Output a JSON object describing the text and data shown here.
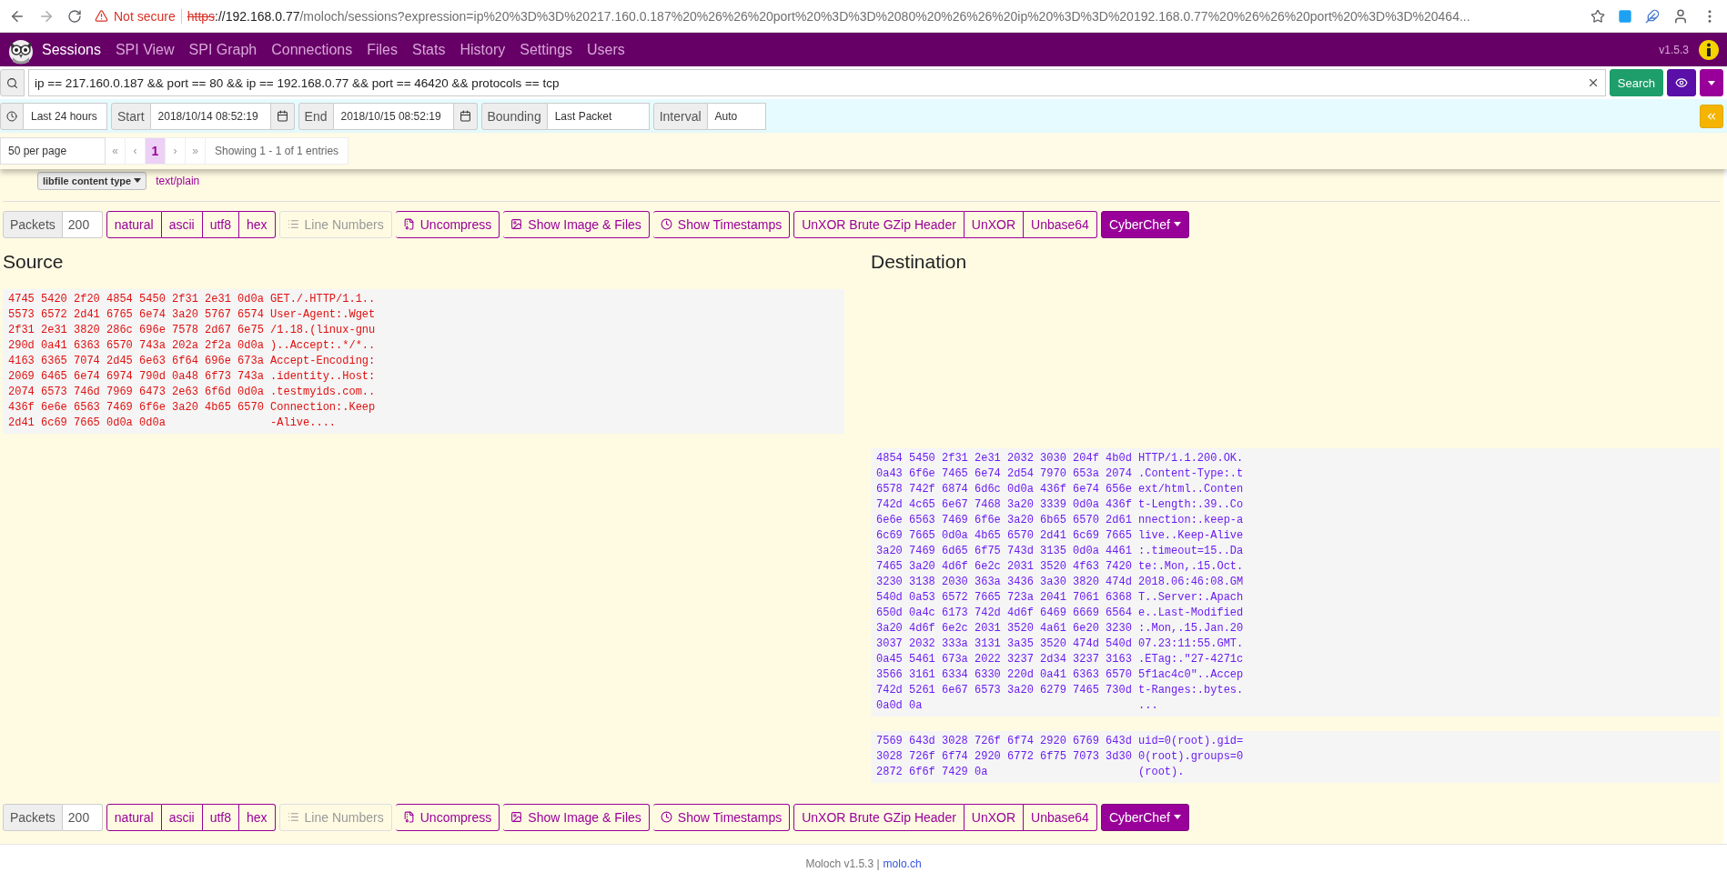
{
  "browser": {
    "security": "Not secure",
    "url": {
      "scheme": "https",
      "host": "://192.168.0.77",
      "path": "/moloch/sessions?expression=ip%20%3D%3D%20217.160.0.187%20%26%26%20port%20%3D%3D%2080%20%26%26%20ip%20%3D%3D%20192.168.0.77%20%26%26%20port%20%3D%3D%20464..."
    }
  },
  "nav": {
    "items": [
      {
        "label": "Sessions",
        "selected": true
      },
      {
        "label": "SPI View",
        "selected": false
      },
      {
        "label": "SPI Graph",
        "selected": false
      },
      {
        "label": "Connections",
        "selected": false
      },
      {
        "label": "Files",
        "selected": false
      },
      {
        "label": "Stats",
        "selected": false
      },
      {
        "label": "History",
        "selected": false
      },
      {
        "label": "Settings",
        "selected": false
      },
      {
        "label": "Users",
        "selected": false
      }
    ],
    "version": "v1.5.3"
  },
  "search": {
    "value": "ip == 217.160.0.187 && port == 80 && ip == 192.168.0.77 && port == 46420 && protocols == tcp",
    "button": "Search"
  },
  "time": {
    "range": "Last 24 hours",
    "start_label": "Start",
    "start": "2018/10/14 08:52:19",
    "end_label": "End",
    "end": "2018/10/15 08:52:19",
    "bounding_label": "Bounding",
    "bounding": "Last Packet",
    "interval_label": "Interval",
    "interval": "Auto"
  },
  "pagination": {
    "per_page": "50 per page",
    "pages": [
      {
        "label": "«",
        "selected": false,
        "disabled": true
      },
      {
        "label": "‹",
        "selected": false,
        "disabled": true
      },
      {
        "label": "1",
        "selected": true,
        "disabled": false
      },
      {
        "label": "›",
        "selected": false,
        "disabled": true
      },
      {
        "label": "»",
        "selected": false,
        "disabled": true
      }
    ],
    "info": "Showing 1 - 1 of 1 entries"
  },
  "libfile": {
    "label": "libfile content type",
    "value": "text/plain"
  },
  "toolbars": [
    {
      "packets_label": "Packets",
      "packets": "200",
      "formats": [
        "natural",
        "ascii",
        "utf8",
        "hex"
      ],
      "buttons": [
        {
          "kind": "lines",
          "label": "Line Numbers",
          "disabled": true
        },
        {
          "kind": "uncompress",
          "label": "Uncompress",
          "disabled": false
        },
        {
          "kind": "image",
          "label": "Show Image & Files",
          "disabled": false
        },
        {
          "kind": "time",
          "label": "Show Timestamps",
          "disabled": false
        }
      ],
      "decoders": [
        "UnXOR Brute GZip Header",
        "UnXOR",
        "Unbase64"
      ],
      "menu": "CyberChef"
    },
    {
      "packets_label": "Packets",
      "packets": "200",
      "formats": [
        "natural",
        "ascii",
        "utf8",
        "hex"
      ],
      "buttons": [
        {
          "kind": "lines",
          "label": "Line Numbers",
          "disabled": true
        },
        {
          "kind": "uncompress",
          "label": "Uncompress",
          "disabled": false
        },
        {
          "kind": "image",
          "label": "Show Image & Files",
          "disabled": false
        },
        {
          "kind": "time",
          "label": "Show Timestamps",
          "disabled": false
        }
      ],
      "decoders": [
        "UnXOR Brute GZip Header",
        "UnXOR",
        "Unbase64"
      ],
      "menu": "CyberChef"
    }
  ],
  "headings": {
    "source": "Source",
    "destination": "Destination"
  },
  "packets": [
    {
      "kind": "source",
      "lines": [
        {
          "hex": "4745 5420 2f20 4854 5450 2f31 2e31 0d0a",
          "ascii": "GET./.HTTP/1.1.."
        },
        {
          "hex": "5573 6572 2d41 6765 6e74 3a20 5767 6574",
          "ascii": "User-Agent:.Wget"
        },
        {
          "hex": "2f31 2e31 3820 286c 696e 7578 2d67 6e75",
          "ascii": "/1.18.(linux-gnu"
        },
        {
          "hex": "290d 0a41 6363 6570 743a 202a 2f2a 0d0a",
          "ascii": ")..Accept:.*/*.."
        },
        {
          "hex": "4163 6365 7074 2d45 6e63 6f64 696e 673a",
          "ascii": "Accept-Encoding:"
        },
        {
          "hex": "2069 6465 6e74 6974 790d 0a48 6f73 743a",
          "ascii": ".identity..Host:"
        },
        {
          "hex": "2074 6573 746d 7969 6473 2e63 6f6d 0d0a",
          "ascii": ".testmyids.com.."
        },
        {
          "hex": "436f 6e6e 6563 7469 6f6e 3a20 4b65 6570",
          "ascii": "Connection:.Keep"
        },
        {
          "hex": "2d41 6c69 7665 0d0a 0d0a",
          "ascii": "-Alive...."
        }
      ]
    },
    {
      "kind": "destination",
      "lines": [
        {
          "hex": "4854 5450 2f31 2e31 2032 3030 204f 4b0d",
          "ascii": "HTTP/1.1.200.OK."
        },
        {
          "hex": "0a43 6f6e 7465 6e74 2d54 7970 653a 2074",
          "ascii": ".Content-Type:.t"
        },
        {
          "hex": "6578 742f 6874 6d6c 0d0a 436f 6e74 656e",
          "ascii": "ext/html..Conten"
        },
        {
          "hex": "742d 4c65 6e67 7468 3a20 3339 0d0a 436f",
          "ascii": "t-Length:.39..Co"
        },
        {
          "hex": "6e6e 6563 7469 6f6e 3a20 6b65 6570 2d61",
          "ascii": "nnection:.keep-a"
        },
        {
          "hex": "6c69 7665 0d0a 4b65 6570 2d41 6c69 7665",
          "ascii": "live..Keep-Alive"
        },
        {
          "hex": "3a20 7469 6d65 6f75 743d 3135 0d0a 4461",
          "ascii": ":.timeout=15..Da"
        },
        {
          "hex": "7465 3a20 4d6f 6e2c 2031 3520 4f63 7420",
          "ascii": "te:.Mon,.15.Oct."
        },
        {
          "hex": "3230 3138 2030 363a 3436 3a30 3820 474d",
          "ascii": "2018.06:46:08.GM"
        },
        {
          "hex": "540d 0a53 6572 7665 723a 2041 7061 6368",
          "ascii": "T..Server:.Apach"
        },
        {
          "hex": "650d 0a4c 6173 742d 4d6f 6469 6669 6564",
          "ascii": "e..Last-Modified"
        },
        {
          "hex": "3a20 4d6f 6e2c 2031 3520 4a61 6e20 3230",
          "ascii": ":.Mon,.15.Jan.20"
        },
        {
          "hex": "3037 2032 333a 3131 3a35 3520 474d 540d",
          "ascii": "07.23:11:55.GMT."
        },
        {
          "hex": "0a45 5461 673a 2022 3237 2d34 3237 3163",
          "ascii": ".ETag:.\"27-4271c"
        },
        {
          "hex": "3566 3161 6334 6330 220d 0a41 6363 6570",
          "ascii": "5f1ac4c0\"..Accep"
        },
        {
          "hex": "742d 5261 6e67 6573 3a20 6279 7465 730d",
          "ascii": "t-Ranges:.bytes."
        },
        {
          "hex": "0a0d 0a",
          "ascii": "..."
        }
      ]
    },
    {
      "kind": "destination",
      "lines": [
        {
          "hex": "7569 643d 3028 726f 6f74 2920 6769 643d",
          "ascii": "uid=0(root).gid="
        },
        {
          "hex": "3028 726f 6f74 2920 6772 6f75 7073 3d30",
          "ascii": "0(root).groups=0"
        },
        {
          "hex": "2872 6f6f 7429 0a",
          "ascii": "(root)."
        }
      ]
    }
  ],
  "footer": {
    "text": "Moloch v1.5.3 |",
    "link": "molo.ch"
  }
}
